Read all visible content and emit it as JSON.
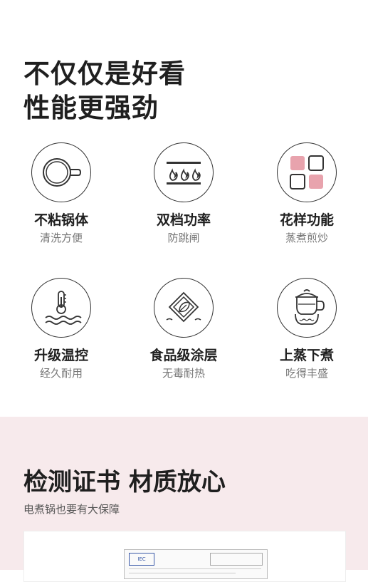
{
  "headline": {
    "line1": "不仅仅是好看",
    "line2": "性能更强劲"
  },
  "features": [
    {
      "title": "不粘锅体",
      "subtitle": "清洗方便",
      "icon": "cup-icon"
    },
    {
      "title": "双档功率",
      "subtitle": "防跳闸",
      "icon": "flame-icon"
    },
    {
      "title": "花样功能",
      "subtitle": "蒸煮煎炒",
      "icon": "grid-squares-icon"
    },
    {
      "title": "升级温控",
      "subtitle": "经久耐用",
      "icon": "thermometer-icon"
    },
    {
      "title": "食品级涂层",
      "subtitle": "无毒耐热",
      "icon": "leaf-shield-icon"
    },
    {
      "title": "上蒸下煮",
      "subtitle": "吃得丰盛",
      "icon": "steamer-pot-icon"
    }
  ],
  "certification": {
    "title": "检测证书  材质放心",
    "subtitle": "电煮锅也要有大保障",
    "logo_text": "IEC"
  },
  "colors": {
    "accent_pink": "#e8a3ad",
    "section_bg": "#f7eaec"
  }
}
